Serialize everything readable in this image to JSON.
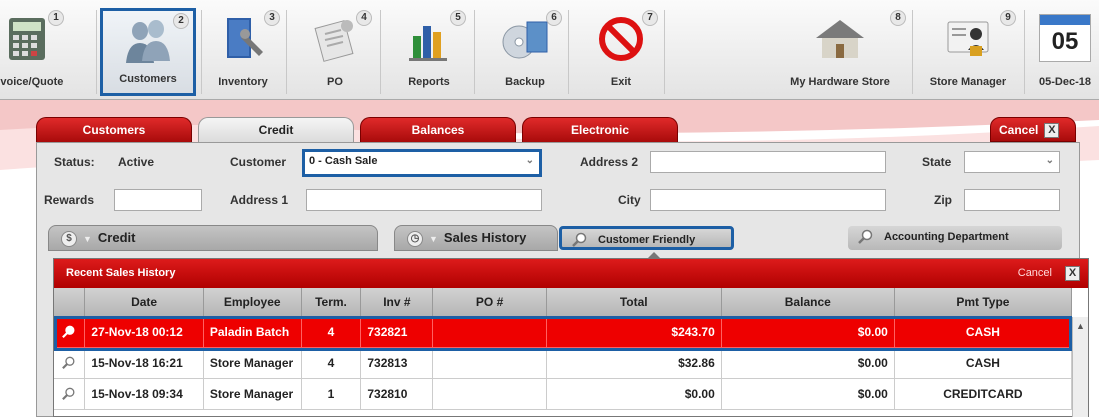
{
  "toolbar": {
    "buttons": [
      {
        "label": "Invoice/Quote",
        "num": "1"
      },
      {
        "label": "Customers",
        "num": "2"
      },
      {
        "label": "Inventory",
        "num": "3"
      },
      {
        "label": "PO",
        "num": "4"
      },
      {
        "label": "Reports",
        "num": "5"
      },
      {
        "label": "Backup",
        "num": "6"
      },
      {
        "label": "Exit",
        "num": "7"
      },
      {
        "label": "My Hardware Store",
        "num": "8"
      },
      {
        "label": "Store Manager",
        "num": "9"
      },
      {
        "label": "05-Dec-18",
        "num": "05"
      }
    ]
  },
  "tabs": [
    "Customers",
    "Credit",
    "Balances",
    "Electronic"
  ],
  "cancel_label": "Cancel",
  "close_glyph": "X",
  "form": {
    "status_label": "Status:",
    "status_value": "Active",
    "rewards_label": "Rewards",
    "customer_label": "Customer",
    "customer_value": "0 - Cash Sale",
    "address1_label": "Address 1",
    "address2_label": "Address 2",
    "city_label": "City",
    "state_label": "State",
    "zip_label": "Zip"
  },
  "sections": {
    "credit": "Credit",
    "sales_history": "Sales History",
    "customer_friendly": "Customer Friendly",
    "accounting_department": "Accounting Department"
  },
  "popup": {
    "title": "Recent Sales History",
    "cancel": "Cancel",
    "columns": [
      "",
      "Date",
      "Employee",
      "Term.",
      "Inv #",
      "PO #",
      "Total",
      "Balance",
      "Pmt Type"
    ],
    "rows": [
      {
        "date": "27-Nov-18 00:12",
        "employee": "Paladin Batch",
        "term": "4",
        "inv": "732821",
        "po": "",
        "total": "$243.70",
        "balance": "$0.00",
        "pmt": "CASH"
      },
      {
        "date": "15-Nov-18 16:21",
        "employee": "Store Manager",
        "term": "4",
        "inv": "732813",
        "po": "",
        "total": "$32.86",
        "balance": "$0.00",
        "pmt": "CASH"
      },
      {
        "date": "15-Nov-18 09:34",
        "employee": "Store Manager",
        "term": "1",
        "inv": "732810",
        "po": "",
        "total": "$0.00",
        "balance": "$0.00",
        "pmt": "CREDITCARD"
      }
    ]
  },
  "colors": {
    "accent_red": "#e00000",
    "highlight_blue": "#1d5fa5"
  }
}
